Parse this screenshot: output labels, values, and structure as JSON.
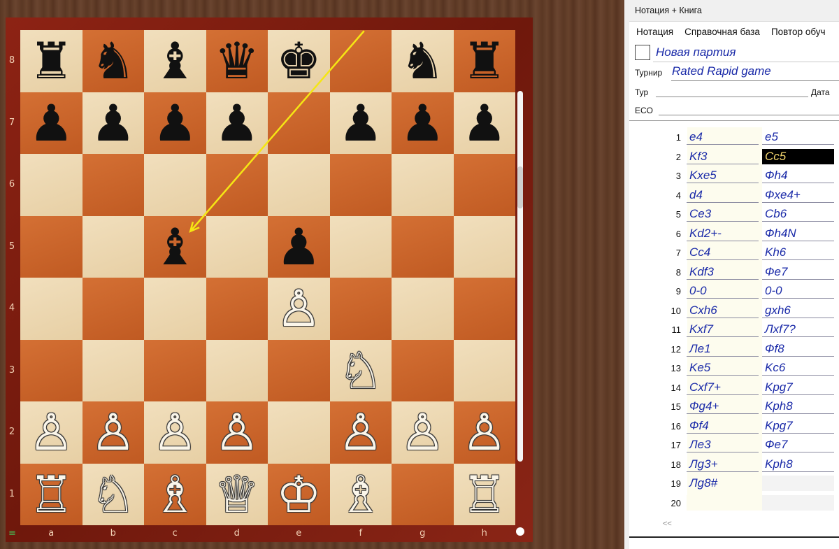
{
  "board": {
    "ranks": [
      "8",
      "7",
      "6",
      "5",
      "4",
      "3",
      "2",
      "1"
    ],
    "files": [
      "a",
      "b",
      "c",
      "d",
      "e",
      "f",
      "g",
      "h"
    ],
    "pieces": {
      "a8": {
        "glyph": "♜",
        "color": "black",
        "name": "black-rook"
      },
      "b8": {
        "glyph": "♞",
        "color": "black",
        "name": "black-knight"
      },
      "c8": {
        "glyph": "♝",
        "color": "black",
        "name": "black-bishop"
      },
      "d8": {
        "glyph": "♛",
        "color": "black",
        "name": "black-queen"
      },
      "e8": {
        "glyph": "♚",
        "color": "black",
        "name": "black-king"
      },
      "g8": {
        "glyph": "♞",
        "color": "black",
        "name": "black-knight"
      },
      "h8": {
        "glyph": "♜",
        "color": "black",
        "name": "black-rook"
      },
      "a7": {
        "glyph": "♟",
        "color": "black",
        "name": "black-pawn"
      },
      "b7": {
        "glyph": "♟",
        "color": "black",
        "name": "black-pawn"
      },
      "c7": {
        "glyph": "♟",
        "color": "black",
        "name": "black-pawn"
      },
      "d7": {
        "glyph": "♟",
        "color": "black",
        "name": "black-pawn"
      },
      "f7": {
        "glyph": "♟",
        "color": "black",
        "name": "black-pawn"
      },
      "g7": {
        "glyph": "♟",
        "color": "black",
        "name": "black-pawn"
      },
      "h7": {
        "glyph": "♟",
        "color": "black",
        "name": "black-pawn"
      },
      "c5": {
        "glyph": "♝",
        "color": "black",
        "name": "black-bishop"
      },
      "e5": {
        "glyph": "♟",
        "color": "black",
        "name": "black-pawn"
      },
      "e4": {
        "glyph": "♙",
        "color": "white",
        "name": "white-pawn"
      },
      "f3": {
        "glyph": "♘",
        "color": "white",
        "name": "white-knight"
      },
      "a2": {
        "glyph": "♙",
        "color": "white",
        "name": "white-pawn"
      },
      "b2": {
        "glyph": "♙",
        "color": "white",
        "name": "white-pawn"
      },
      "c2": {
        "glyph": "♙",
        "color": "white",
        "name": "white-pawn"
      },
      "d2": {
        "glyph": "♙",
        "color": "white",
        "name": "white-pawn"
      },
      "f2": {
        "glyph": "♙",
        "color": "white",
        "name": "white-pawn"
      },
      "g2": {
        "glyph": "♙",
        "color": "white",
        "name": "white-pawn"
      },
      "h2": {
        "glyph": "♙",
        "color": "white",
        "name": "white-pawn"
      },
      "a1": {
        "glyph": "♖",
        "color": "white",
        "name": "white-rook"
      },
      "b1": {
        "glyph": "♘",
        "color": "white",
        "name": "white-knight"
      },
      "c1": {
        "glyph": "♗",
        "color": "white",
        "name": "white-bishop"
      },
      "d1": {
        "glyph": "♕",
        "color": "white",
        "name": "white-queen"
      },
      "e1": {
        "glyph": "♔",
        "color": "white",
        "name": "white-king"
      },
      "f1": {
        "glyph": "♗",
        "color": "white",
        "name": "white-bishop"
      },
      "h1": {
        "glyph": "♖",
        "color": "white",
        "name": "white-rook"
      }
    },
    "last_move_arrow": {
      "from": "f8",
      "to": "c5",
      "color": "#f5e614"
    }
  },
  "panel": {
    "title": "Нотация + Книга",
    "tabs": [
      "Нотация",
      "Справочная база",
      "Повтор обуч"
    ],
    "game_title": "Новая партия",
    "tournament_label": "Турнир",
    "tournament_value": "Rated Rapid game",
    "round_label": "Тур",
    "date_label": "Дата",
    "eco_label": "ECO",
    "nav_prev": "<<"
  },
  "moves": [
    {
      "n": "1",
      "w": "e4",
      "b": "e5"
    },
    {
      "n": "2",
      "w": "Kf3",
      "b": "Cc5",
      "current": "b"
    },
    {
      "n": "3",
      "w": "Kxe5",
      "b": "Фh4"
    },
    {
      "n": "4",
      "w": "d4",
      "b": "Фxe4+"
    },
    {
      "n": "5",
      "w": "Ce3",
      "b": "Cb6"
    },
    {
      "n": "6",
      "w": "Kd2+-",
      "b": "Фh4N"
    },
    {
      "n": "7",
      "w": "Cc4",
      "b": "Kh6"
    },
    {
      "n": "8",
      "w": "Kdf3",
      "b": "Фe7"
    },
    {
      "n": "9",
      "w": "0-0",
      "b": "0-0"
    },
    {
      "n": "10",
      "w": "Cxh6",
      "b": "gxh6"
    },
    {
      "n": "11",
      "w": "Kxf7",
      "b": "Лxf7?"
    },
    {
      "n": "12",
      "w": "Ле1",
      "b": "Фf8"
    },
    {
      "n": "13",
      "w": "Ke5",
      "b": "Kc6"
    },
    {
      "n": "14",
      "w": "Cxf7+",
      "b": "Kpg7"
    },
    {
      "n": "15",
      "w": "Фg4+",
      "b": "Kph8"
    },
    {
      "n": "16",
      "w": "Фf4",
      "b": "Kpg7"
    },
    {
      "n": "17",
      "w": "Ле3",
      "b": "Фe7"
    },
    {
      "n": "18",
      "w": "Лg3+",
      "b": "Kph8"
    },
    {
      "n": "19",
      "w": "Лg8#",
      "b": ""
    },
    {
      "n": "20",
      "w": "",
      "b": ""
    }
  ]
}
